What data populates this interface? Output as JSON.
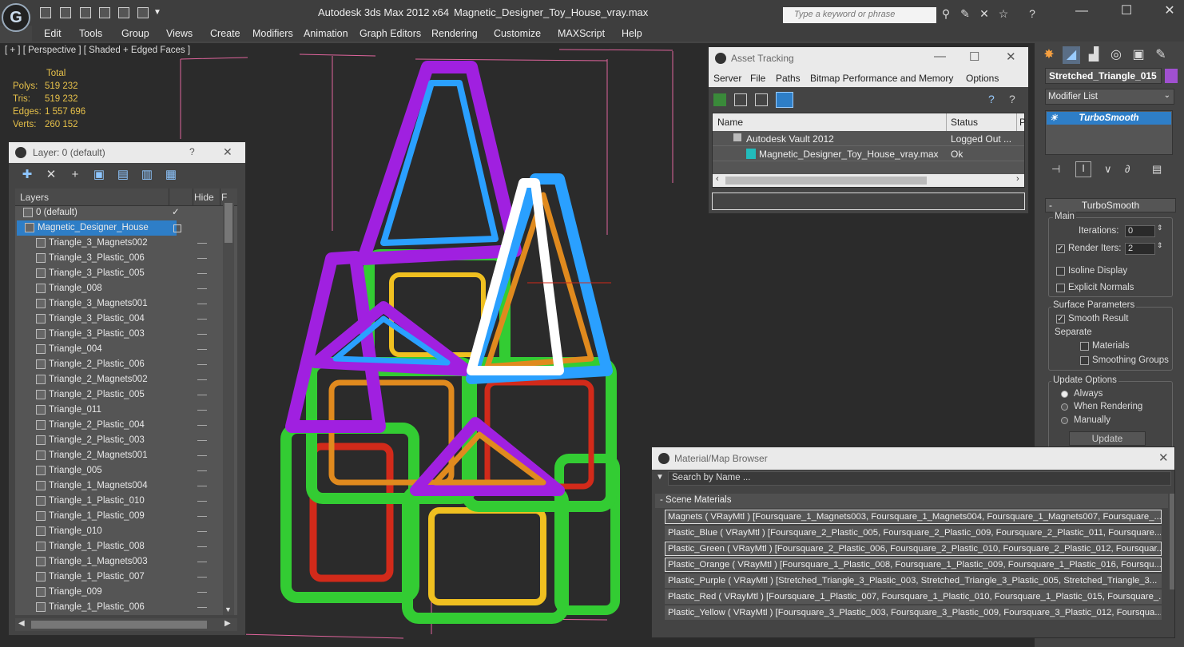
{
  "app": {
    "title": "Autodesk 3ds Max  2012 x64",
    "file": "Magnetic_Designer_Toy_House_vray.max",
    "search_placeholder": "Type a keyword or phrase"
  },
  "menu": [
    "Edit",
    "Tools",
    "Group",
    "Views",
    "Create",
    "Modifiers",
    "Animation",
    "Graph Editors",
    "Rendering",
    "Customize",
    "MAXScript",
    "Help"
  ],
  "viewport": {
    "label": "[ + ] [ Perspective ] [ Shaded + Edged Faces ]",
    "stats": {
      "header": "Total",
      "rows": [
        {
          "k": "Polys:",
          "v": "519 232"
        },
        {
          "k": "Tris:",
          "v": "519 232"
        },
        {
          "k": "Edges:",
          "v": "1 557 696"
        },
        {
          "k": "Verts:",
          "v": "260 152"
        }
      ]
    }
  },
  "layer_panel": {
    "title": "Layer: 0 (default)",
    "help": "?",
    "col_layers": "Layers",
    "col_hide": "Hide",
    "col_f": "F",
    "rows": [
      "0 (default)",
      "Magnetic_Designer_House",
      "Triangle_3_Magnets002",
      "Triangle_3_Plastic_006",
      "Triangle_3_Plastic_005",
      "Triangle_008",
      "Triangle_3_Magnets001",
      "Triangle_3_Plastic_004",
      "Triangle_3_Plastic_003",
      "Triangle_004",
      "Triangle_2_Plastic_006",
      "Triangle_2_Magnets002",
      "Triangle_2_Plastic_005",
      "Triangle_011",
      "Triangle_2_Plastic_004",
      "Triangle_2_Plastic_003",
      "Triangle_2_Magnets001",
      "Triangle_005",
      "Triangle_1_Magnets004",
      "Triangle_1_Plastic_010",
      "Triangle_1_Plastic_009",
      "Triangle_010",
      "Triangle_1_Plastic_008",
      "Triangle_1_Magnets003",
      "Triangle_1_Plastic_007",
      "Triangle_009",
      "Triangle_1_Plastic_006"
    ]
  },
  "command_panel": {
    "object_name": "Stretched_Triangle_015",
    "modifier_list": "Modifier List",
    "stack_item": "TurboSmooth",
    "rollout": "TurboSmooth",
    "main_label": "Main",
    "iterations_label": "Iterations:",
    "iterations": "0",
    "render_iters_label": "Render Iters:",
    "render_iters": "2",
    "isoline": "Isoline Display",
    "explicit": "Explicit Normals",
    "surface_label": "Surface Parameters",
    "smooth_result": "Smooth Result",
    "separate": "Separate",
    "materials": "Materials",
    "smoothing_groups": "Smoothing Groups",
    "update_label": "Update Options",
    "always": "Always",
    "when_rendering": "When Rendering",
    "manually": "Manually",
    "update_btn": "Update"
  },
  "asset": {
    "title": "Asset Tracking",
    "menu": [
      "Server",
      "File",
      "Paths",
      "Bitmap Performance and Memory",
      "Options"
    ],
    "col_name": "Name",
    "col_status": "Status",
    "col_p": "P",
    "rows": [
      {
        "name": "Autodesk Vault 2012",
        "status": "Logged Out ..."
      },
      {
        "name": "Magnetic_Designer_Toy_House_vray.max",
        "status": "Ok"
      }
    ]
  },
  "matbrowser": {
    "title": "Material/Map Browser",
    "search": "Search by Name ...",
    "section": "- Scene Materials",
    "rows": [
      "Magnets  ( VRayMtl ) [Foursquare_1_Magnets003, Foursquare_1_Magnets004, Foursquare_1_Magnets007, Foursquare_...",
      "Plastic_Blue  ( VRayMtl ) [Foursquare_2_Plastic_005, Foursquare_2_Plastic_009, Foursquare_2_Plastic_011, Foursquare...",
      "Plastic_Green  ( VRayMtl ) [Foursquare_2_Plastic_006, Foursquare_2_Plastic_010, Foursquare_2_Plastic_012, Foursquar...",
      "Plastic_Orange  ( VRayMtl ) [Foursquare_1_Plastic_008, Foursquare_1_Plastic_009, Foursquare_1_Plastic_016, Foursqu...",
      "Plastic_Purple  ( VRayMtl )  [Stretched_Triangle_3_Plastic_003, Stretched_Triangle_3_Plastic_005, Stretched_Triangle_3...",
      "Plastic_Red  ( VRayMtl ) [Foursquare_1_Plastic_007, Foursquare_1_Plastic_010, Foursquare_1_Plastic_015, Foursquare_...",
      "Plastic_Yellow  ( VRayMtl ) [Foursquare_3_Plastic_003, Foursquare_3_Plastic_009, Foursquare_3_Plastic_012, Foursqua..."
    ]
  },
  "colors": {
    "green": "#33cc33",
    "purple": "#a020e0",
    "blue": "#2aa0ff",
    "orange": "#e08a1e",
    "red": "#d22a1a",
    "yellow": "#f0c020",
    "white": "#ffffff",
    "selection": "#2e7ec7"
  }
}
